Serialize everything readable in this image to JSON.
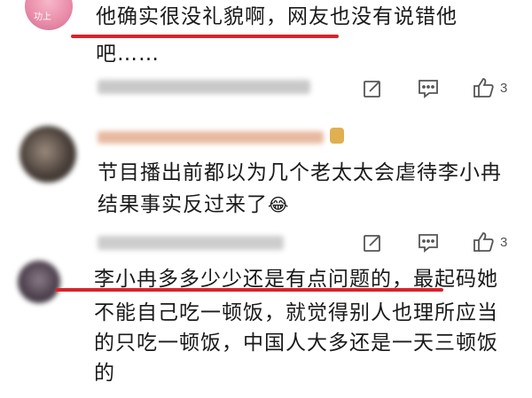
{
  "comments": [
    {
      "text_line1": "他确实很没礼貌啊，网友也没有说错他",
      "text_line2": "吧……",
      "like_count": "3",
      "avatar_caption": "功上"
    },
    {
      "text_line1": "节目播出前都以为几个老太太会虐待李小冉",
      "text_line2": "结果事实反过来了",
      "emoji": "😂",
      "like_count": "3"
    },
    {
      "text_line1": "李小冉多多少少还是有点问题的，最起码她",
      "text_line2": "不能自己吃一顿饭，就觉得别人也理所应当",
      "text_line3": "的只吃一顿饭，中国人大多还是一天三顿饭",
      "text_line4": "的"
    }
  ],
  "icons": [
    "edit-icon",
    "comment-icon",
    "thumbs-up-icon"
  ],
  "colors": {
    "underline": "#d8232a",
    "text": "#1a1a1a",
    "icon": "#555555"
  }
}
